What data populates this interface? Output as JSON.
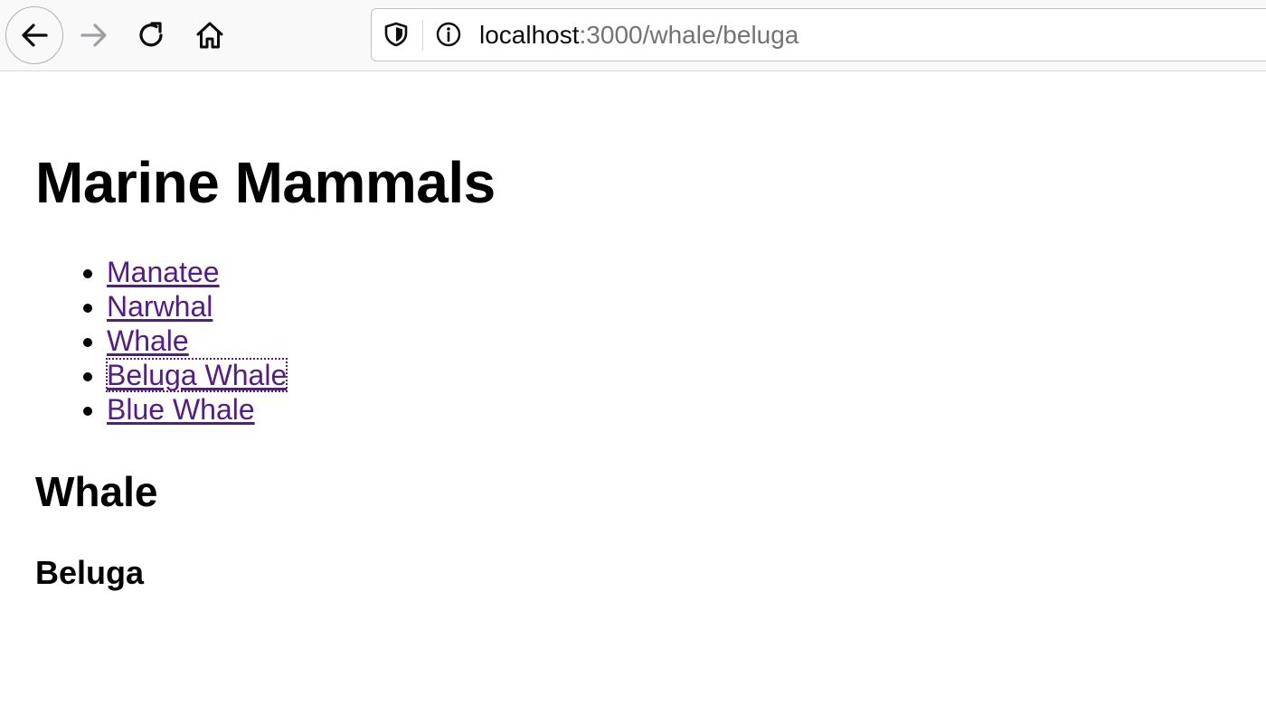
{
  "browser": {
    "url_host": "localhost",
    "url_path": ":3000/whale/beluga",
    "icons": {
      "back": "arrow-left-icon",
      "forward": "arrow-right-icon",
      "reload": "reload-icon",
      "home": "home-icon",
      "tracking": "shield-icon",
      "site_info": "info-icon"
    },
    "forward_enabled": false
  },
  "page": {
    "title": "Marine Mammals",
    "links": [
      {
        "label": "Manatee"
      },
      {
        "label": "Narwhal"
      },
      {
        "label": "Whale"
      },
      {
        "label": "Beluga Whale",
        "focused": true
      },
      {
        "label": "Blue Whale"
      }
    ],
    "section_title": "Whale",
    "sub_title": "Beluga"
  },
  "colors": {
    "visited_link": "#551a8b",
    "toolbar_bg": "#f9f9fa",
    "url_path": "#737373"
  }
}
